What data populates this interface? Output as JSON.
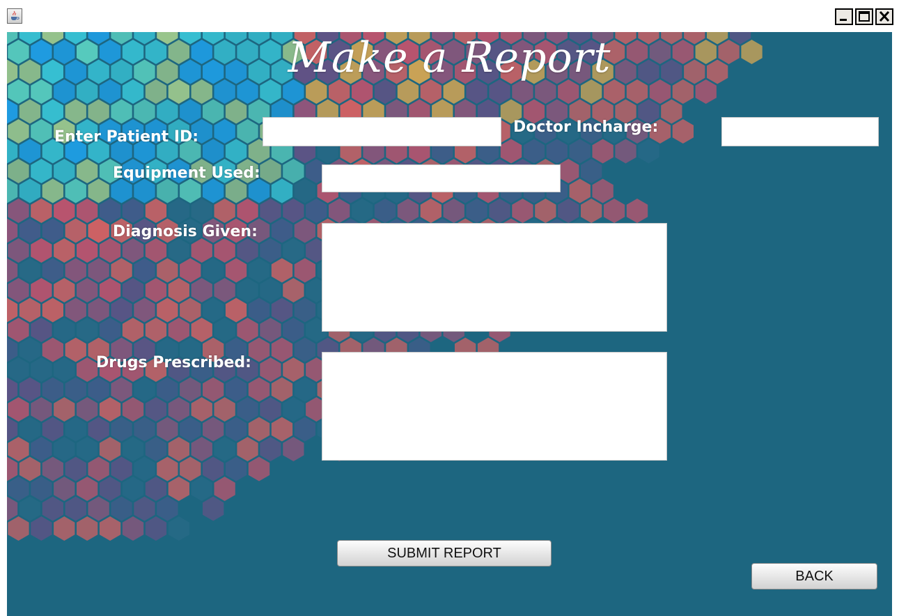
{
  "window": {
    "app_icon": "java-cup-icon",
    "controls": [
      {
        "name": "minimize",
        "icon": "minimize-icon"
      },
      {
        "name": "maximize",
        "icon": "maximize-icon"
      },
      {
        "name": "close",
        "icon": "close-icon"
      }
    ]
  },
  "form": {
    "title": "Make a Report",
    "patient_id_label": "Enter Patient ID:",
    "patient_id_value": "",
    "doctor_label": "Doctor Incharge:",
    "doctor_value": "",
    "equipment_label": "Equipment Used:",
    "equipment_value": "",
    "diagnosis_label": "Diagnosis Given:",
    "diagnosis_value": "",
    "drugs_label": "Drugs Prescribed:",
    "drugs_value": ""
  },
  "buttons": {
    "submit_label": "SUBMIT REPORT",
    "back_label": "BACK"
  },
  "colors": {
    "panel_background": "#1d6680",
    "hexagon_palette": [
      "#1fa0e8",
      "#38c4d6",
      "#5ad0c0",
      "#9ec98d",
      "#f2b04c",
      "#f0605e",
      "#d9506a",
      "#a4527a",
      "#6e4f86",
      "#4a5a8c",
      "#2a6a88"
    ]
  }
}
